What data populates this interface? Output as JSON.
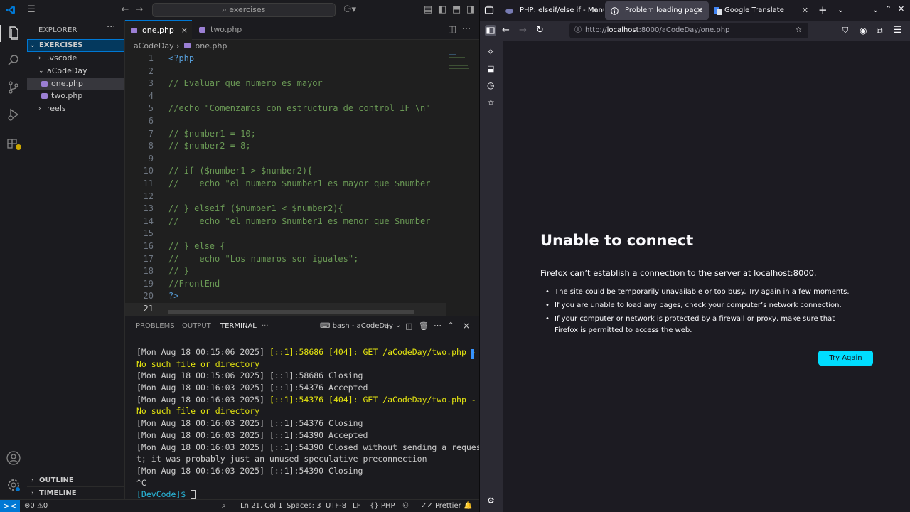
{
  "vscode": {
    "search_text": "exercises",
    "explorer": {
      "title": "EXPLORER",
      "more": "···",
      "root": "EXERCISES",
      "items": [
        {
          "label": ".vscode"
        },
        {
          "label": "aCodeDay"
        },
        {
          "label": "one.php"
        },
        {
          "label": "two.php"
        },
        {
          "label": "reels"
        }
      ],
      "outline": "OUTLINE",
      "timeline": "TIMELINE"
    },
    "tabs": [
      {
        "label": "one.php",
        "close": "×"
      },
      {
        "label": "two.php"
      }
    ],
    "breadcrumb": {
      "folder": "aCodeDay",
      "sep": "›",
      "file": "one.php"
    },
    "code_lines": [
      {
        "n": "1",
        "text": "<?php",
        "kind": "kw"
      },
      {
        "n": "2",
        "text": "",
        "kind": ""
      },
      {
        "n": "3",
        "text": "// Evaluar que numero es mayor",
        "kind": "cmt"
      },
      {
        "n": "4",
        "text": "",
        "kind": ""
      },
      {
        "n": "5",
        "text": "//echo \"Comenzamos con estructura de control IF \\n\"",
        "kind": "cmt"
      },
      {
        "n": "6",
        "text": "",
        "kind": ""
      },
      {
        "n": "7",
        "text": "// $number1 = 10;",
        "kind": "cmt"
      },
      {
        "n": "8",
        "text": "// $number2 = 8;",
        "kind": "cmt"
      },
      {
        "n": "9",
        "text": "",
        "kind": ""
      },
      {
        "n": "10",
        "text": "// if ($number1 > $number2){",
        "kind": "cmt"
      },
      {
        "n": "11",
        "text": "//    echo \"el numero $number1 es mayor que $number",
        "kind": "cmt"
      },
      {
        "n": "12",
        "text": "",
        "kind": ""
      },
      {
        "n": "13",
        "text": "// } elseif ($number1 < $number2){",
        "kind": "cmt"
      },
      {
        "n": "14",
        "text": "//    echo \"el numero $number1 es menor que $number",
        "kind": "cmt"
      },
      {
        "n": "15",
        "text": "",
        "kind": ""
      },
      {
        "n": "16",
        "text": "// } else {",
        "kind": "cmt"
      },
      {
        "n": "17",
        "text": "//    echo \"Los numeros son iguales\";",
        "kind": "cmt"
      },
      {
        "n": "18",
        "text": "// }",
        "kind": "cmt"
      },
      {
        "n": "19",
        "text": "//FrontEnd",
        "kind": "cmt"
      },
      {
        "n": "20",
        "text": "?>",
        "kind": "kw"
      },
      {
        "n": "21",
        "text": "",
        "kind": ""
      }
    ],
    "panel": {
      "tabs": [
        "PROBLEMS",
        "OUTPUT",
        "TERMINAL"
      ],
      "more": "···",
      "terminal_name": "bash - aCodeDay",
      "lines": [
        {
          "a": "[Mon Aug 18 00:15:06 2025] ",
          "b": "[::1]:58686 [404]: GET /aCodeDay/two.php -",
          "style": "yel"
        },
        {
          "a": "",
          "b": "No such file or directory",
          "style": "yel"
        },
        {
          "a": "[Mon Aug 18 00:15:06 2025] ",
          "b": "[::1]:58686 Closing",
          "style": ""
        },
        {
          "a": "[Mon Aug 18 00:16:03 2025] ",
          "b": "[::1]:54376 Accepted",
          "style": ""
        },
        {
          "a": "[Mon Aug 18 00:16:03 2025] ",
          "b": "[::1]:54376 [404]: GET /aCodeDay/two.php -",
          "style": "yel"
        },
        {
          "a": "",
          "b": "No such file or directory",
          "style": "yel"
        },
        {
          "a": "[Mon Aug 18 00:16:03 2025] ",
          "b": "[::1]:54376 Closing",
          "style": ""
        },
        {
          "a": "[Mon Aug 18 00:16:03 2025] ",
          "b": "[::1]:54390 Accepted",
          "style": ""
        },
        {
          "a": "[Mon Aug 18 00:16:03 2025] ",
          "b": "[::1]:54390 Closed without sending a reques",
          "style": ""
        },
        {
          "a": "",
          "b": "t; it was probably just an unused speculative preconnection",
          "style": ""
        },
        {
          "a": "[Mon Aug 18 00:16:03 2025] ",
          "b": "[::1]:54390 Closing",
          "style": ""
        },
        {
          "a": "",
          "b": "^C",
          "style": ""
        }
      ],
      "prompt": "[DevCode]$ "
    },
    "status": {
      "remote": "><",
      "errors": "0",
      "warnings": "0",
      "position": "Ln 21, Col 1",
      "spaces": "Spaces: 3",
      "encoding": "UTF-8",
      "eol": "LF",
      "language": "PHP",
      "formatter": "Prettier"
    }
  },
  "firefox": {
    "tabs": [
      {
        "label": "PHP: elseif/else if - Manual",
        "favicon": "php-favicon"
      },
      {
        "label": "Problem loading page",
        "favicon": "info-icon"
      },
      {
        "label": "Google Translate",
        "favicon": "translate-icon"
      }
    ],
    "url_prefix": "http://",
    "url_host": "localhost",
    "url_path": ":8000/aCodeDay/one.php",
    "error": {
      "title": "Unable to connect",
      "lead": "Firefox can’t establish a connection to the server at localhost:8000.",
      "bullets": [
        "The site could be temporarily unavailable or too busy. Try again in a few moments.",
        "If you are unable to load any pages, check your computer’s network connection.",
        "If your computer or network is protected by a firewall or proxy, make sure that Firefox is permitted to access the web."
      ],
      "button": "Try Again"
    },
    "colors": {
      "accent": "#00ddff",
      "background": "#1c1b22"
    }
  }
}
